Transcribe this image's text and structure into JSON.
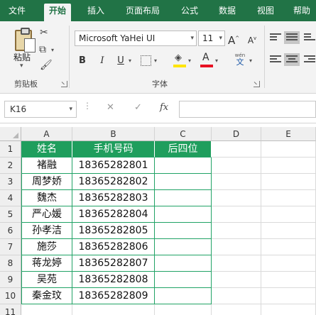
{
  "ribbon": {
    "tabs": [
      "文件",
      "开始",
      "插入",
      "页面布局",
      "公式",
      "数据",
      "视图",
      "帮助"
    ],
    "active_tab": "开始",
    "clipboard": {
      "paste_label": "粘贴",
      "group_label": "剪贴板"
    },
    "font": {
      "family": "Microsoft YaHei UI",
      "size": "11",
      "bold": "B",
      "italic": "I",
      "underline": "U",
      "grow": "A",
      "shrink": "A",
      "font_color_glyph": "A",
      "phonetic_top": "wén",
      "phonetic_bottom": "文",
      "group_label": "字体",
      "fill_color": "#ffe500",
      "font_color": "#e81123"
    }
  },
  "formula_bar": {
    "name_box": "K16",
    "dots": "⋮",
    "cancel_icon": "✕",
    "enter_icon": "✓",
    "fx_label": "fx",
    "formula": ""
  },
  "sheet": {
    "columns": [
      "A",
      "B",
      "C",
      "D",
      "E"
    ],
    "rows": [
      "1",
      "2",
      "3",
      "4",
      "5",
      "6",
      "7",
      "8",
      "9",
      "10",
      "11"
    ],
    "table": {
      "header": [
        "姓名",
        "手机号码",
        "后四位"
      ],
      "rows": [
        [
          "褚融",
          "18365282801",
          ""
        ],
        [
          "周梦娇",
          "18365282802",
          ""
        ],
        [
          "魏杰",
          "18365282803",
          ""
        ],
        [
          "严心媛",
          "18365282804",
          ""
        ],
        [
          "孙孝洁",
          "18365282805",
          ""
        ],
        [
          "施莎",
          "18365282806",
          ""
        ],
        [
          "蒋龙婷",
          "18365282807",
          ""
        ],
        [
          "吴苑",
          "18365282808",
          ""
        ],
        [
          "秦金玟",
          "18365282809",
          ""
        ]
      ]
    },
    "header_color": "#1f9e5d"
  }
}
